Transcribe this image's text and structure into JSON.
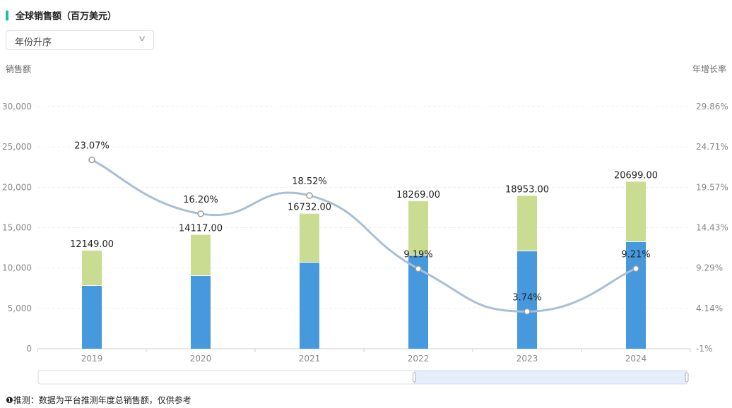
{
  "header": {
    "title": "全球销售额（百万美元）"
  },
  "sort_select": {
    "value": "年份升序"
  },
  "footnote": "❶推测：数据为平台推测年度总销售额，仅供参考",
  "colors": {
    "bar_lower": "#4699dd",
    "bar_upper": "#c9dc91",
    "line": "#a8bfd6",
    "accent": "#1fbfa6"
  },
  "chart_data": {
    "type": "bar+line",
    "title": "全球销售额（百万美元）",
    "ylabel_left": "销售额",
    "ylabel_right": "年增长率",
    "categories": [
      "2019",
      "2020",
      "2021",
      "2022",
      "2023",
      "2024"
    ],
    "ylim_left": [
      0,
      30000
    ],
    "yticks_left": [
      "0",
      "5,000",
      "10,000",
      "15,000",
      "20,000",
      "25,000",
      "30,000"
    ],
    "ylim_right": [
      -1,
      29.86
    ],
    "yticks_right": [
      "-1%",
      "4.14%",
      "9.29%",
      "14.43%",
      "19.57%",
      "24.71%",
      "29.86%"
    ],
    "series": [
      {
        "name": "lower",
        "type": "bar",
        "values": [
          7870,
          9100,
          10760,
          11640,
          12160,
          13300
        ]
      },
      {
        "name": "total",
        "type": "bar",
        "values": [
          12149,
          14117,
          16732,
          18269,
          18953,
          20699
        ],
        "labels": [
          "12149.00",
          "14117.00",
          "16732.00",
          "18269.00",
          "18953.00",
          "20699.00"
        ]
      },
      {
        "name": "growth",
        "type": "line",
        "values": [
          23.07,
          16.2,
          18.52,
          9.19,
          3.74,
          9.21
        ],
        "labels": [
          "23.07%",
          "16.20%",
          "18.52%",
          "9.19%",
          "3.74%",
          "9.21%"
        ]
      }
    ],
    "grid": true,
    "zoom_range": [
      0.58,
      1.0
    ]
  }
}
